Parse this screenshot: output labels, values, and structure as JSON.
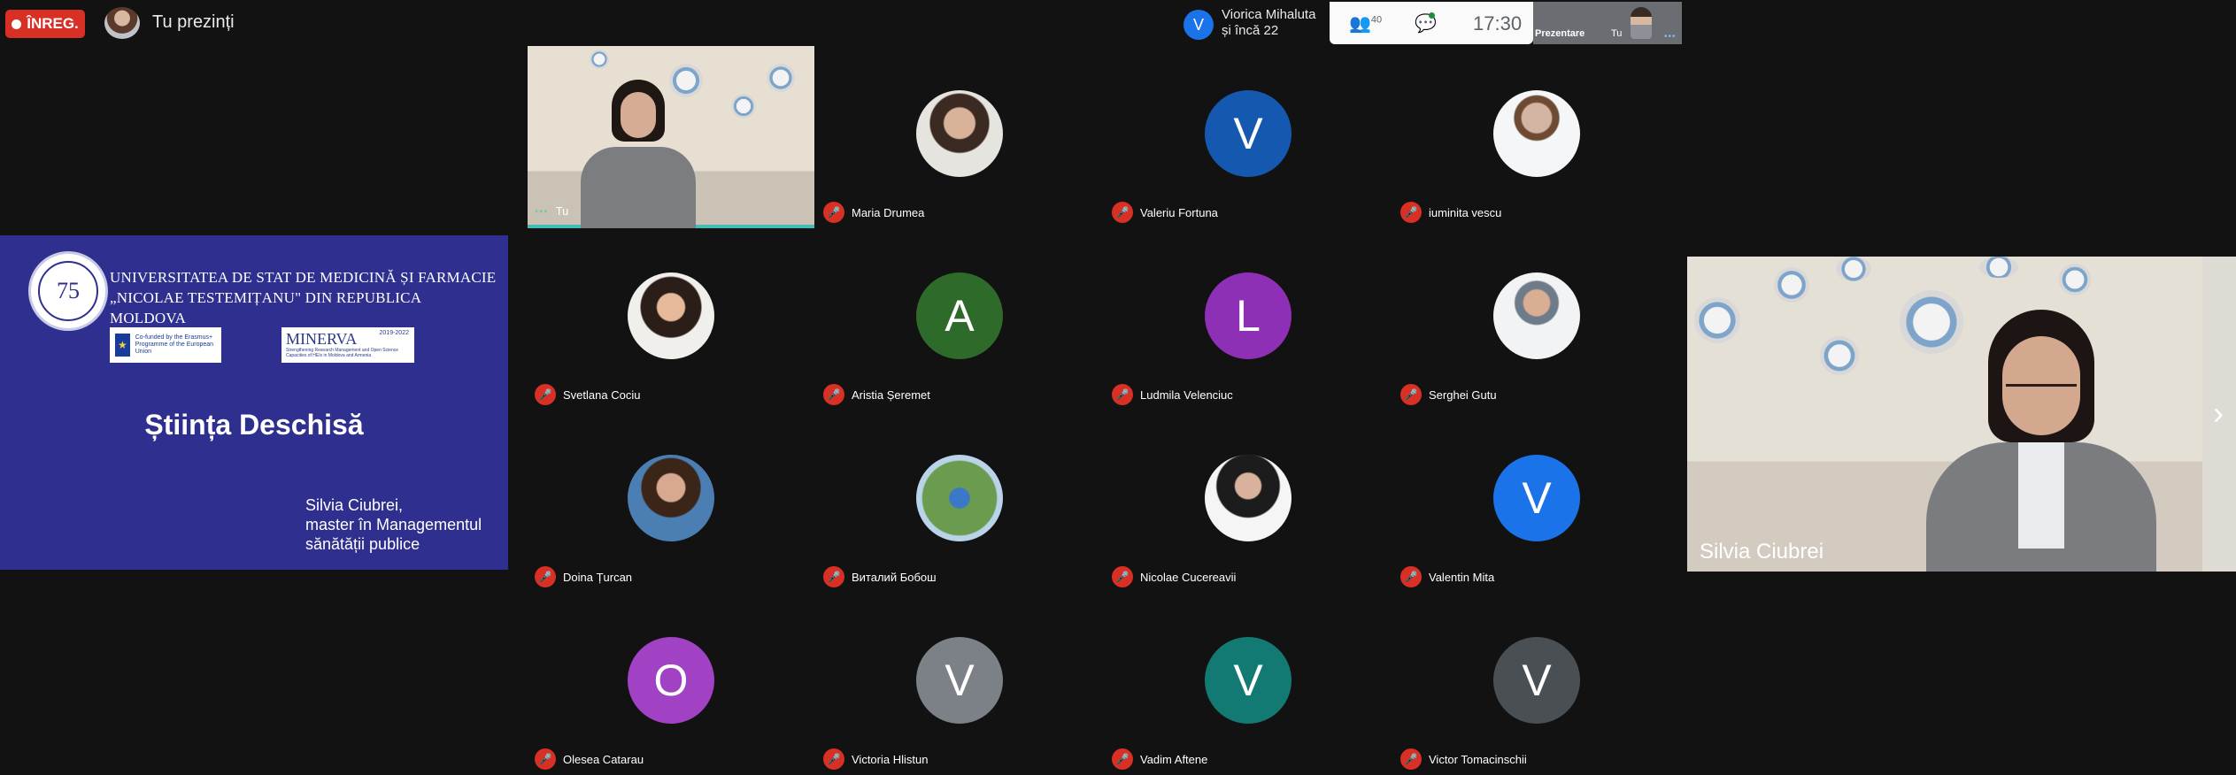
{
  "topbar": {
    "rec_label": "ÎNREG.",
    "presenting_label": "Tu prezinți",
    "joined_initial": "V",
    "joined_line1": "Viorica Mihaluta",
    "joined_line2": "și încă 22",
    "people_count": "40",
    "time": "17:30",
    "mini_label": "Prezentare",
    "mini_self": "Tu"
  },
  "slide": {
    "seal_text": "75",
    "university_line1": "UNIVERSITATEA DE STAT DE MEDICINĂ ȘI FARMACIE",
    "university_line2": "„NICOLAE TESTEMIȚANU\" DIN REPUBLICA MOLDOVA",
    "eu_logo_text": "Co-funded by the Erasmus+ Programme of the European Union",
    "minerva_name": "MINERVA",
    "minerva_years": "2019-2022",
    "minerva_sub": "Strengthening Research Management and Open Science Capacities of HEIs in Moldova and Armenia",
    "title": "Știința Deschisă",
    "author_line1": "Silvia Ciubrei,",
    "author_line2": "master în Managementul",
    "author_line3": "sănătății publice"
  },
  "self_tile": {
    "label": "Tu"
  },
  "participants": [
    {
      "name": "Maria Drumea",
      "initial": "",
      "color": "",
      "photo": "photo"
    },
    {
      "name": "Valeriu Fortuna",
      "initial": "V",
      "color": "#1558b0",
      "photo": ""
    },
    {
      "name": "iuminita vescu",
      "initial": "",
      "color": "",
      "photo": "photo3"
    },
    {
      "name": "Svetlana Cociu",
      "initial": "",
      "color": "",
      "photo": "photo4"
    },
    {
      "name": "Aristia Șeremet",
      "initial": "A",
      "color": "#2e6b2a",
      "photo": ""
    },
    {
      "name": "Ludmila Velenciuc",
      "initial": "L",
      "color": "#8e30b5",
      "photo": ""
    },
    {
      "name": "Serghei Gutu",
      "initial": "",
      "color": "",
      "photo": "photo5"
    },
    {
      "name": "Doina Țurcan",
      "initial": "",
      "color": "",
      "photo": "photo6"
    },
    {
      "name": "Виталий Бобош",
      "initial": "",
      "color": "",
      "photo": "photo7"
    },
    {
      "name": "Nicolae Cucereavii",
      "initial": "",
      "color": "",
      "photo": "photo8"
    },
    {
      "name": "Valentin Mita",
      "initial": "V",
      "color": "#1a73e8",
      "photo": ""
    },
    {
      "name": "Olesea Catarau",
      "initial": "O",
      "color": "#a142c4",
      "photo": ""
    },
    {
      "name": "Victoria Hlistun",
      "initial": "V",
      "color": "#7c8187",
      "photo": ""
    },
    {
      "name": "Vadim Aftene",
      "initial": "V",
      "color": "#127a72",
      "photo": ""
    },
    {
      "name": "Victor Tomacinschii",
      "initial": "V",
      "color": "#4a4f54",
      "photo": ""
    }
  ],
  "spotlight": {
    "name": "Silvia Ciubrei"
  }
}
